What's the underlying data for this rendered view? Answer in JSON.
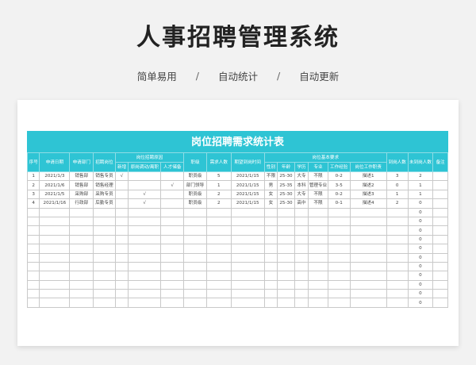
{
  "page": {
    "title": "人事招聘管理系统",
    "tags": [
      "简单易用",
      "自动统计",
      "自动更新"
    ],
    "tag_separator": "/"
  },
  "sheet": {
    "banner": "岗位招聘需求统计表",
    "headers": {
      "seq": "序号",
      "apply_date": "申请日期",
      "apply_dept": "申请部门",
      "position": "招聘岗位",
      "reason_group": "岗位招聘原因",
      "reason_new": "新增",
      "reason_transfer": "原岗调动/离职",
      "reason_reserve": "人才储备",
      "rank": "职级",
      "headcount": "需求人数",
      "expected_date": "期望到岗时间",
      "req_group": "岗位基本要求",
      "gender": "性别",
      "age": "年龄",
      "education": "学历",
      "major": "专业",
      "experience": "工作经验",
      "job_desc": "岗位工作职责",
      "arrived": "到岗人数",
      "not_arrived": "未到岗人数",
      "remark": "备注"
    },
    "rows": [
      {
        "seq": "1",
        "apply_date": "2021/1/3",
        "apply_dept": "销售部",
        "position": "销售专员",
        "reason_new": "√",
        "reason_transfer": "",
        "reason_reserve": "",
        "rank": "职员级",
        "headcount": "5",
        "expected_date": "2021/1/15",
        "gender": "不限",
        "age": "25-30",
        "education": "大专",
        "major": "不限",
        "experience": "0-2",
        "job_desc": "描述1",
        "arrived": "3",
        "not_arrived": "2",
        "remark": ""
      },
      {
        "seq": "2",
        "apply_date": "2021/1/6",
        "apply_dept": "销售部",
        "position": "销售经理",
        "reason_new": "",
        "reason_transfer": "",
        "reason_reserve": "√",
        "rank": "部门领导",
        "headcount": "1",
        "expected_date": "2021/1/15",
        "gender": "男",
        "age": "25-35",
        "education": "本科",
        "major": "管理专业",
        "experience": "3-5",
        "job_desc": "描述2",
        "arrived": "0",
        "not_arrived": "1",
        "remark": ""
      },
      {
        "seq": "3",
        "apply_date": "2021/1/5",
        "apply_dept": "采购部",
        "position": "采购专员",
        "reason_new": "",
        "reason_transfer": "√",
        "reason_reserve": "",
        "rank": "职员级",
        "headcount": "2",
        "expected_date": "2021/1/15",
        "gender": "女",
        "age": "25-30",
        "education": "大专",
        "major": "不限",
        "experience": "0-2",
        "job_desc": "描述3",
        "arrived": "1",
        "not_arrived": "1",
        "remark": ""
      },
      {
        "seq": "4",
        "apply_date": "2021/1/16",
        "apply_dept": "行政部",
        "position": "后勤专员",
        "reason_new": "",
        "reason_transfer": "√",
        "reason_reserve": "",
        "rank": "职员级",
        "headcount": "2",
        "expected_date": "2021/1/15",
        "gender": "女",
        "age": "25-30",
        "education": "高中",
        "major": "不限",
        "experience": "0-1",
        "job_desc": "描述4",
        "arrived": "2",
        "not_arrived": "0",
        "remark": ""
      },
      {
        "not_arrived": "0"
      },
      {
        "not_arrived": "0"
      },
      {
        "not_arrived": "0"
      },
      {
        "not_arrived": "0"
      },
      {
        "not_arrived": "0"
      },
      {
        "not_arrived": "0"
      },
      {
        "not_arrived": "0"
      },
      {
        "not_arrived": "0"
      },
      {
        "not_arrived": "0"
      },
      {
        "not_arrived": "0"
      },
      {
        "not_arrived": "0"
      }
    ]
  }
}
